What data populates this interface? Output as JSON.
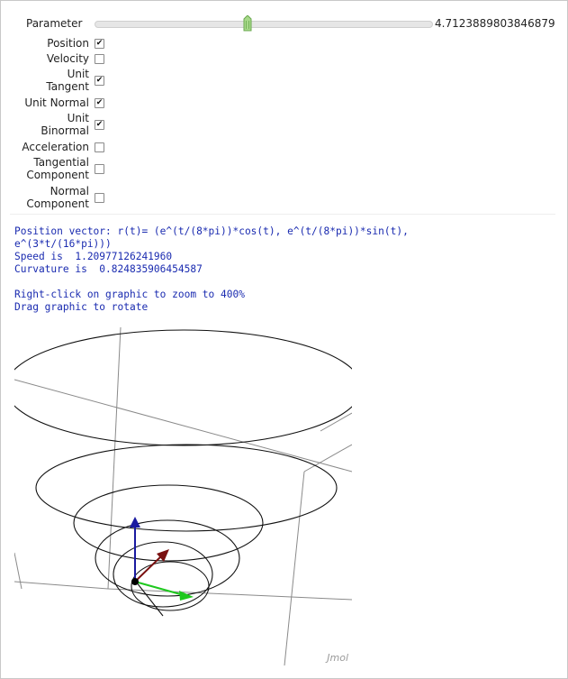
{
  "controls": {
    "parameter_label": "Parameter",
    "parameter_value": "4.7123889803846879",
    "parameter_fraction": 0.45
  },
  "options": [
    {
      "label_lines": [
        "Position"
      ],
      "checked": true
    },
    {
      "label_lines": [
        "Velocity"
      ],
      "checked": false
    },
    {
      "label_lines": [
        "Unit",
        "Tangent"
      ],
      "checked": true
    },
    {
      "label_lines": [
        "Unit Normal"
      ],
      "checked": true
    },
    {
      "label_lines": [
        "Unit",
        "Binormal"
      ],
      "checked": true
    },
    {
      "label_lines": [
        "Acceleration"
      ],
      "checked": false
    },
    {
      "label_lines": [
        "Tangential",
        "Component"
      ],
      "checked": false
    },
    {
      "label_lines": [
        "Normal",
        "Component"
      ],
      "checked": false
    }
  ],
  "info": {
    "line1": "Position vector: r(t)= (e^(t/(8*pi))*cos(t), e^(t/(8*pi))*sin(t),",
    "line2": "e^(3*t/(16*pi)))",
    "line3": "Speed is  1.20977126241960",
    "line4": "Curvature is  0.824835906454587",
    "line5": "Right-click on graphic to zoom to 400%",
    "line6": "Drag graphic to rotate"
  },
  "viewer": {
    "brand": "Jmol",
    "colors": {
      "curve": "#111111",
      "box": "#8a8a8a",
      "binormal": "#1a1aa0",
      "normal": "#7a1010",
      "tangent": "#1ec81e",
      "point": "#000000"
    }
  },
  "colors": {
    "info_text": "#1a2bb0",
    "slider_thumb": "#8ec86a"
  }
}
